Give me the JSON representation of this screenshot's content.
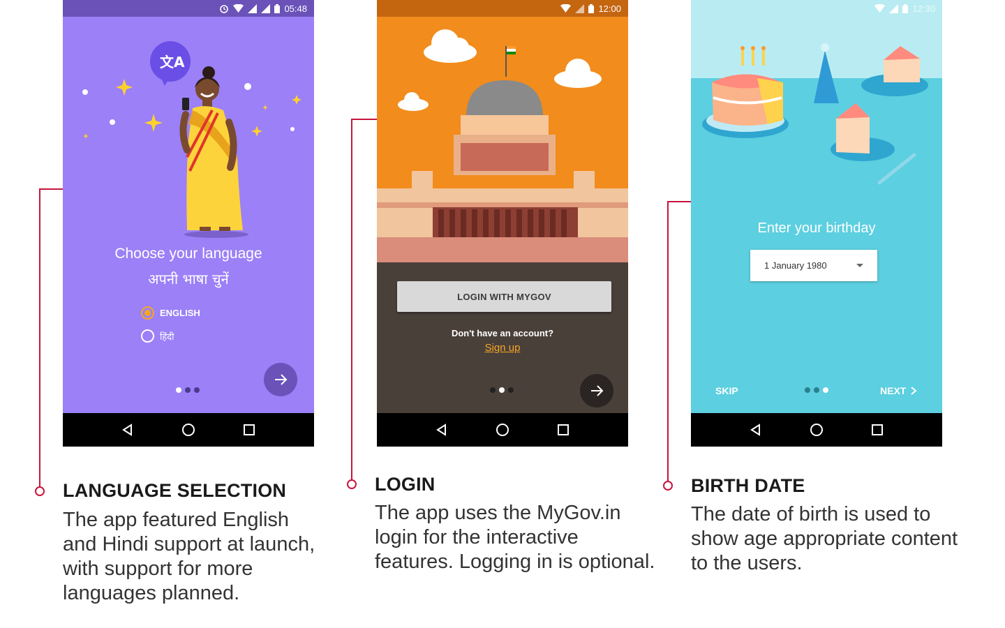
{
  "colors": {
    "connector": "#c8143c",
    "phone1_bg": "#9b80f7",
    "phone2_bg": "#4a403a",
    "phone3_bg": "#5ccfe0",
    "accent_orange": "#f5a623"
  },
  "phone1": {
    "status_time": "05:48",
    "title": "Choose your language",
    "subtitle": "अपनी भाषा चुनें",
    "options": [
      {
        "label": "ENGLISH",
        "selected": true
      },
      {
        "label": "हिंदी",
        "selected": false
      }
    ],
    "page_index": 0,
    "page_count": 3,
    "icons": [
      "translate-icon",
      "arrow-right-icon"
    ]
  },
  "phone2": {
    "status_time": "12:00",
    "login_button": "LOGIN WITH MYGOV",
    "no_account_text": "Don't have an account?",
    "signup_link": "Sign up",
    "page_index": 1,
    "page_count": 3
  },
  "phone3": {
    "status_time": "12:30",
    "title": "Enter your birthday",
    "date_value": "1 January 1980",
    "skip_label": "SKIP",
    "next_label": "NEXT",
    "page_index": 2,
    "page_count": 3
  },
  "captions": [
    {
      "title": "LANGUAGE SELECTION",
      "lines": [
        "The app featured English",
        "and Hindi support at launch,",
        "with support for more",
        "languages planned."
      ]
    },
    {
      "title": "LOGIN",
      "lines": [
        "The app uses the MyGov.in",
        "login for the interactive",
        "features. Logging in is optional."
      ]
    },
    {
      "title": "BIRTH DATE",
      "lines": [
        "The date of birth is used to",
        "show age appropriate content",
        "to the users."
      ]
    }
  ]
}
